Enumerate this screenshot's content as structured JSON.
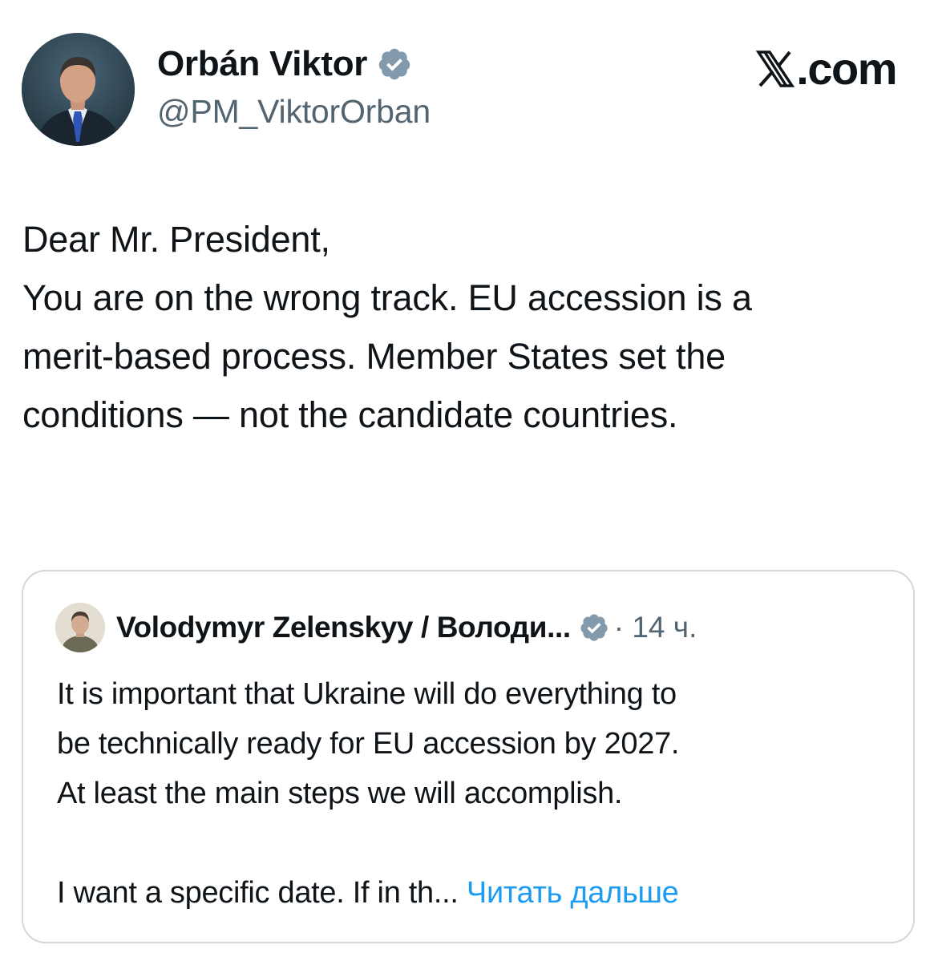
{
  "tweet": {
    "author": {
      "display_name": "Orbán Viktor",
      "handle": "@PM_ViktorOrban",
      "avatar": "portrait-avatar",
      "verified": true,
      "verified_icon": "verified-badge-icon"
    },
    "site": {
      "logo": "x-logo-icon",
      "domain": ".com"
    },
    "body_lines": [
      "Dear Mr. President,",
      "You are on the wrong track. EU accession is a",
      "merit-based process. Member States set the",
      "conditions — not the candidate countries."
    ]
  },
  "quoted_tweet": {
    "author": {
      "display_name": "Volodymyr Zelenskyy / Володи...",
      "avatar": "portrait-avatar",
      "verified": true,
      "verified_icon": "verified-badge-icon"
    },
    "meta": "· 14 ч.",
    "body_lines": [
      "It is important that Ukraine will do everything to",
      "be technically ready for EU accession by 2027.",
      "At least the main steps we will accomplish."
    ],
    "truncated_line": "I want a specific date. If in th...",
    "read_more_label": "Читать дальше"
  },
  "colors": {
    "text_primary": "#0f1419",
    "text_secondary": "#536471",
    "link": "#1d9bf0",
    "border": "#cfd9de",
    "verified_badge": "#829aab",
    "background": "#ffffff"
  }
}
